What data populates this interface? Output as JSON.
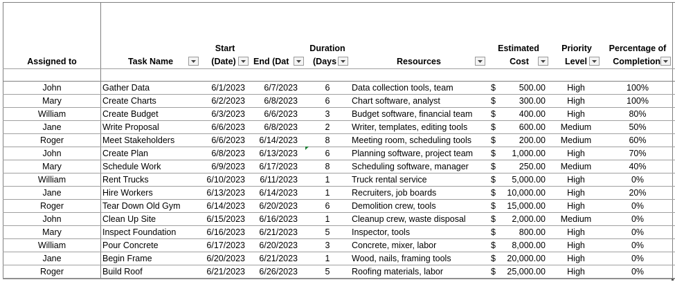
{
  "headers": {
    "assigned_to": "Assigned to",
    "task_name": "Task Name",
    "start_line1": "Start",
    "start_line2": "(Date)",
    "end": "End  (Dat",
    "duration_line1": "Duration",
    "duration_line2": "(Days",
    "resources": "Resources",
    "cost_line1": "Estimated",
    "cost_line2": "Cost",
    "priority_line1": "Priority",
    "priority_line2": "Level",
    "pct_line1": "Percentage of",
    "pct_line2": "Completion"
  },
  "currency_symbol": "$",
  "rows": [
    {
      "assigned": "John",
      "task": "Gather Data",
      "start": "6/1/2023",
      "end": "6/7/2023",
      "duration": "6",
      "resources": "Data collection tools, team",
      "cost": "500.00",
      "priority": "High",
      "pct": "100%"
    },
    {
      "assigned": "Mary",
      "task": "Create Charts",
      "start": "6/2/2023",
      "end": "6/8/2023",
      "duration": "6",
      "resources": "Chart software, analyst",
      "cost": "300.00",
      "priority": "High",
      "pct": "100%"
    },
    {
      "assigned": "William",
      "task": "Create Budget",
      "start": "6/3/2023",
      "end": "6/6/2023",
      "duration": "3",
      "resources": "Budget software, financial team",
      "cost": "400.00",
      "priority": "High",
      "pct": "80%"
    },
    {
      "assigned": "Jane",
      "task": "Write Proposal",
      "start": "6/6/2023",
      "end": "6/8/2023",
      "duration": "2",
      "resources": "Writer, templates, editing tools",
      "cost": "600.00",
      "priority": "Medium",
      "pct": "50%"
    },
    {
      "assigned": "Roger",
      "task": "Meet Stakeholders",
      "start": "6/6/2023",
      "end": "6/14/2023",
      "duration": "8",
      "resources": "Meeting room, scheduling tools",
      "cost": "200.00",
      "priority": "Medium",
      "pct": "60%"
    },
    {
      "assigned": "John",
      "task": "Create Plan",
      "start": "6/8/2023",
      "end": "6/13/2023",
      "duration": "6",
      "resources": "Planning software, project team",
      "cost": "1,000.00",
      "priority": "High",
      "pct": "70%"
    },
    {
      "assigned": "Mary",
      "task": "Schedule Work",
      "start": "6/9/2023",
      "end": "6/17/2023",
      "duration": "8",
      "resources": "Scheduling software, manager",
      "cost": "250.00",
      "priority": "Medium",
      "pct": "40%"
    },
    {
      "assigned": "William",
      "task": "Rent Trucks",
      "start": "6/10/2023",
      "end": "6/11/2023",
      "duration": "1",
      "resources": "Truck rental service",
      "cost": "5,000.00",
      "priority": "High",
      "pct": "0%"
    },
    {
      "assigned": "Jane",
      "task": "Hire Workers",
      "start": "6/13/2023",
      "end": "6/14/2023",
      "duration": "1",
      "resources": "Recruiters, job boards",
      "cost": "10,000.00",
      "priority": "High",
      "pct": "20%"
    },
    {
      "assigned": "Roger",
      "task": "Tear Down Old Gym",
      "start": "6/14/2023",
      "end": "6/20/2023",
      "duration": "6",
      "resources": "Demolition crew, tools",
      "cost": "15,000.00",
      "priority": "High",
      "pct": "0%"
    },
    {
      "assigned": "John",
      "task": "Clean Up Site",
      "start": "6/15/2023",
      "end": "6/16/2023",
      "duration": "1",
      "resources": "Cleanup crew, waste disposal",
      "cost": "2,000.00",
      "priority": "Medium",
      "pct": "0%"
    },
    {
      "assigned": "Mary",
      "task": "Inspect Foundation",
      "start": "6/16/2023",
      "end": "6/21/2023",
      "duration": "5",
      "resources": "Inspector, tools",
      "cost": "800.00",
      "priority": "High",
      "pct": "0%"
    },
    {
      "assigned": "William",
      "task": "Pour Concrete",
      "start": "6/17/2023",
      "end": "6/20/2023",
      "duration": "3",
      "resources": "Concrete, mixer, labor",
      "cost": "8,000.00",
      "priority": "High",
      "pct": "0%"
    },
    {
      "assigned": "Jane",
      "task": "Begin Frame",
      "start": "6/20/2023",
      "end": "6/21/2023",
      "duration": "1",
      "resources": "Wood, nails, framing tools",
      "cost": "20,000.00",
      "priority": "High",
      "pct": "0%"
    },
    {
      "assigned": "Roger",
      "task": "Build Roof",
      "start": "6/21/2023",
      "end": "6/26/2023",
      "duration": "5",
      "resources": "Roofing materials, labor",
      "cost": "25,000.00",
      "priority": "High",
      "pct": "0%"
    }
  ]
}
